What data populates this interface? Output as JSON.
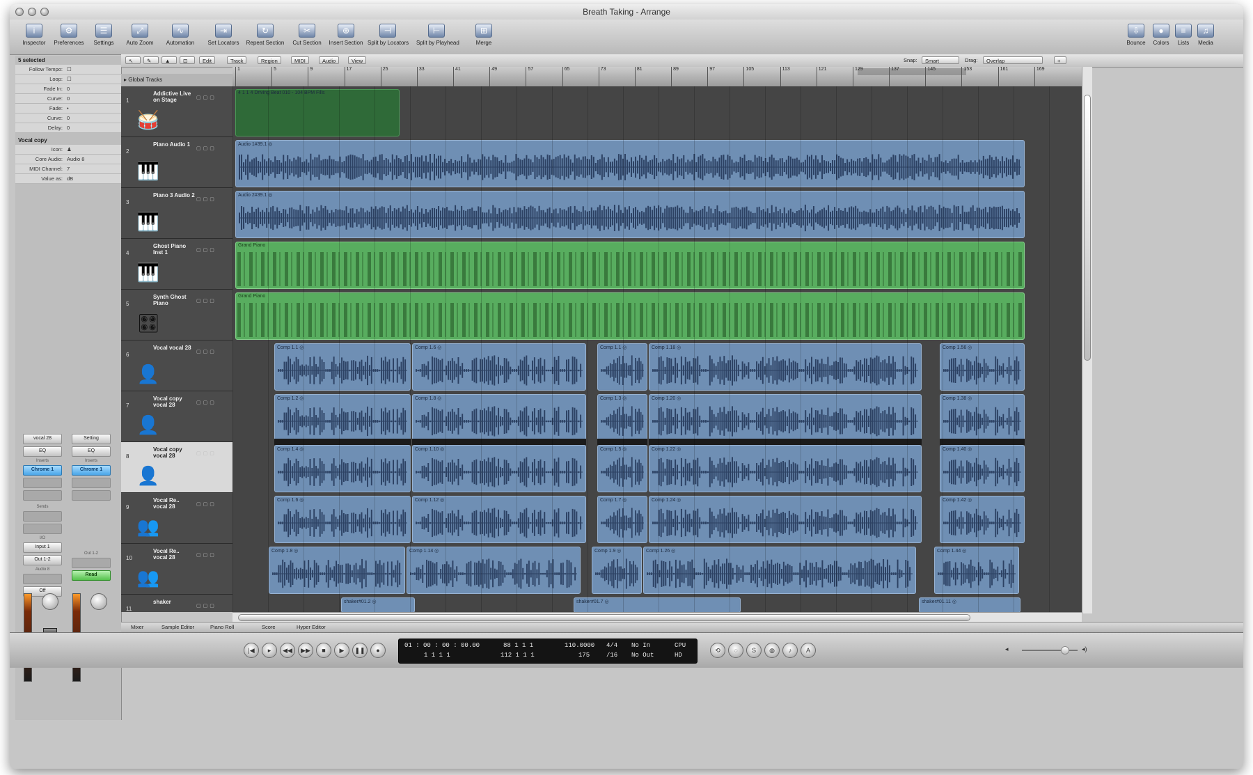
{
  "window": {
    "title": "Breath Taking - Arrange"
  },
  "toolbar": {
    "left": [
      {
        "label": "Inspector",
        "icon": "inspector-icon",
        "glyph": "i"
      },
      {
        "label": "Preferences",
        "icon": "preferences-icon",
        "glyph": "⚙"
      },
      {
        "label": "Settings",
        "icon": "settings-icon",
        "glyph": "☰"
      },
      {
        "label": "Auto Zoom",
        "icon": "zoom-icon",
        "glyph": "⤢"
      },
      {
        "label": "Automation",
        "icon": "automation-icon",
        "glyph": "∿"
      },
      {
        "label": "Set Locators",
        "icon": "locator-icon",
        "glyph": "⇥"
      },
      {
        "label": "Repeat Section",
        "icon": "repeat-icon",
        "glyph": "↻"
      },
      {
        "label": "Cut Section",
        "icon": "scissors-icon",
        "glyph": "✂"
      },
      {
        "label": "Insert Section",
        "icon": "insert-icon",
        "glyph": "⊕"
      },
      {
        "label": "Split by Locators",
        "icon": "split-icon",
        "glyph": "⊣"
      },
      {
        "label": "Split by Playhead",
        "icon": "split-playhead-icon",
        "glyph": "⊢"
      },
      {
        "label": "Merge",
        "icon": "merge-icon",
        "glyph": "⊞"
      }
    ],
    "right": [
      {
        "label": "Bounce",
        "icon": "bounce-icon",
        "glyph": "⇩"
      },
      {
        "label": "Colors",
        "icon": "colors-icon",
        "glyph": "●"
      },
      {
        "label": "Lists",
        "icon": "lists-icon",
        "glyph": "≡"
      },
      {
        "label": "Media",
        "icon": "media-icon",
        "glyph": "♫"
      }
    ]
  },
  "inspector": {
    "region_header": "5 selected",
    "region_params": [
      {
        "k": "Follow Tempo:",
        "v": "☐"
      },
      {
        "k": "Loop:",
        "v": "☐"
      },
      {
        "k": "Fade In:",
        "v": "0"
      },
      {
        "k": "Curve:",
        "v": "0"
      },
      {
        "k": "Fade:",
        "v": "•"
      },
      {
        "k": "Curve:",
        "v": "0"
      },
      {
        "k": "Delay:",
        "v": "0"
      }
    ],
    "track_header": "Vocal copy",
    "track_params": [
      {
        "k": "Icon:",
        "v": "♟"
      },
      {
        "k": "Core Audio:",
        "v": "Audio 8"
      },
      {
        "k": "MIDI Channel:",
        "v": "7"
      },
      {
        "k": "Value as:",
        "v": "dB"
      }
    ],
    "strip_left": {
      "name": "vocal 28",
      "eq": "EQ",
      "send_label": "Inserts",
      "send": "Chrome 1",
      "sends_label": "Sends",
      "io_label": "I/O",
      "input": "Input 1",
      "output": "Out 1-2",
      "audio_label": "Audio 8",
      "automation": "Off"
    },
    "strip_right": {
      "name": "Setting",
      "eq": "EQ",
      "send_label": "Inserts",
      "send": "Chrome 1",
      "output_label": "Out 1-2",
      "automation": "Read"
    }
  },
  "local_menu": {
    "items": [
      "Edit",
      "Track",
      "Region",
      "MIDI",
      "Audio",
      "View"
    ],
    "snap_label": "Snap:",
    "snap_value": "Smart",
    "drag_label": "Drag:",
    "drag_value": "Overlap"
  },
  "global_tracks": {
    "label": "Global Tracks"
  },
  "ruler": {
    "bars": [
      "1",
      "5",
      "9",
      "17",
      "25",
      "33",
      "41",
      "49",
      "57",
      "65",
      "73",
      "81",
      "89",
      "97",
      "105",
      "113",
      "121",
      "129",
      "137",
      "145",
      "153",
      "161",
      "169"
    ]
  },
  "tracks": [
    {
      "num": "1",
      "name": "Addictive Live on Stage",
      "icon": "drum-kit-icon",
      "glyph": "🥁",
      "selected": false
    },
    {
      "num": "2",
      "name": "Piano Audio 1",
      "icon": "grand-piano-icon",
      "glyph": "🎹",
      "selected": false
    },
    {
      "num": "3",
      "name": "Piano 3 Audio 2",
      "icon": "grand-piano-icon",
      "glyph": "🎹",
      "selected": false
    },
    {
      "num": "4",
      "name": "Ghost Piano Inst 1",
      "icon": "upright-piano-icon",
      "glyph": "🎹",
      "selected": false
    },
    {
      "num": "5",
      "name": "Synth Ghost Piano",
      "icon": "synth-icon",
      "glyph": "🎛",
      "selected": false
    },
    {
      "num": "6",
      "name": "Vocal vocal 28",
      "icon": "singer-icon",
      "glyph": "👤",
      "selected": false
    },
    {
      "num": "7",
      "name": "Vocal copy vocal 28",
      "icon": "singer-icon",
      "glyph": "👤",
      "selected": false
    },
    {
      "num": "8",
      "name": "Vocal copy vocal 28",
      "icon": "singer-icon",
      "glyph": "👤",
      "selected": true
    },
    {
      "num": "9",
      "name": "Vocal Re.. vocal 28",
      "icon": "choir-icon",
      "glyph": "👥",
      "selected": false
    },
    {
      "num": "10",
      "name": "Vocal Re.. vocal 28",
      "icon": "choir-icon",
      "glyph": "👥",
      "selected": false
    },
    {
      "num": "11",
      "name": "shaker",
      "icon": "shaker-icon",
      "glyph": "",
      "selected": false
    }
  ],
  "regions": {
    "drums": {
      "name": "4 1 1 4 Driving Beat 010 - 104 BPM Fills"
    },
    "audio": [
      {
        "name": "Audio 1#39.1 ◎"
      },
      {
        "name": "Audio 2#39.1 ◎"
      }
    ],
    "midi": [
      {
        "name": "Grand Piano"
      },
      {
        "name": "Grand Piano"
      }
    ],
    "comp_rows": [
      {
        "names": [
          "Comp 1.1 ◎",
          "Comp 1.6 ◎",
          "Comp 1.1 ◎",
          "Comp 1.18 ◎",
          "Comp 1.56 ◎"
        ]
      },
      {
        "names": [
          "Comp 1.2 ◎",
          "Comp 1.8 ◎",
          "Comp 1.3 ◎",
          "Comp 1.20 ◎",
          "Comp 1.38 ◎"
        ]
      },
      {
        "names": [
          "Comp 1.4 ◎",
          "Comp 1.10 ◎",
          "Comp 1.5 ◎",
          "Comp 1.22 ◎",
          "Comp 1.40 ◎"
        ]
      },
      {
        "names": [
          "Comp 1.6 ◎",
          "Comp 1.12 ◎",
          "Comp 1.7 ◎",
          "Comp 1.24 ◎",
          "Comp 1.42 ◎"
        ]
      },
      {
        "names": [
          "Comp 1.8 ◎",
          "Comp 1.14 ◎",
          "Comp 1.9 ◎",
          "Comp 1.26 ◎",
          "Comp 1.44 ◎"
        ]
      }
    ],
    "shaker": [
      {
        "name": "shaker#01.2 ◎"
      },
      {
        "name": "shaker#01.7 ◎"
      },
      {
        "name": "shaker#01.11 ◎"
      }
    ]
  },
  "bottom_tabs": [
    "Mixer",
    "Sample Editor",
    "Piano Roll",
    "Score",
    "Hyper Editor"
  ],
  "transport": {
    "buttons": [
      {
        "name": "go-to-beginning-button",
        "glyph": "|◀"
      },
      {
        "name": "play-from-selection-button",
        "glyph": "▸"
      },
      {
        "name": "rewind-button",
        "glyph": "◀◀"
      },
      {
        "name": "fast-forward-button",
        "glyph": "▶▶"
      },
      {
        "name": "stop-button",
        "glyph": "■"
      },
      {
        "name": "play-button",
        "glyph": "▶"
      },
      {
        "name": "pause-button",
        "glyph": "❚❚"
      },
      {
        "name": "record-button",
        "glyph": "●"
      }
    ],
    "right_buttons": [
      {
        "name": "cycle-button",
        "glyph": "⟲"
      },
      {
        "name": "replace-button",
        "glyph": "◌"
      },
      {
        "name": "solo-button",
        "glyph": "S"
      },
      {
        "name": "sync-button",
        "glyph": "◍"
      },
      {
        "name": "click-button",
        "glyph": "♪"
      },
      {
        "name": "tuner-button",
        "glyph": "A"
      }
    ],
    "lcd": {
      "smpte": "01 : 00 : 00 : 00.00",
      "position": "88    1    1    1",
      "tempo": "110.0000",
      "signature": "4/4",
      "in": "No In",
      "bars_bottom": "1    1    1    1",
      "end": "112    1    1    1",
      "tempo2": "175",
      "division": "/16",
      "out": "No Out",
      "cpu_label": "CPU",
      "hd_label": "HD"
    }
  }
}
